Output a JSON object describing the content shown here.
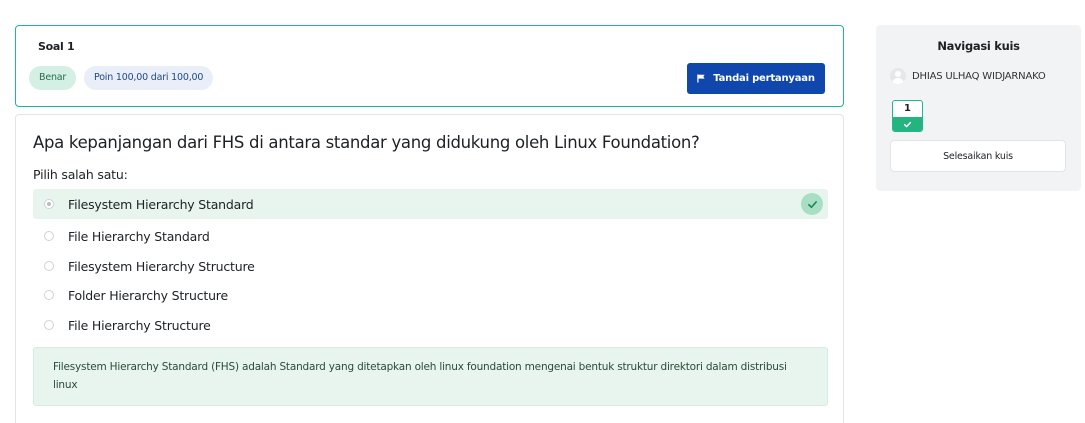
{
  "question_info": {
    "number_label": "Soal 1",
    "state": "Benar",
    "grade": "Poin 100,00 dari 100,00",
    "flag_label": "Tandai pertanyaan"
  },
  "question": {
    "text": "Apa kepanjangan dari FHS di antara standar yang didukung oleh Linux Foundation?",
    "prompt": "Pilih salah satu:",
    "answers": [
      {
        "label": "Filesystem Hierarchy Standard",
        "selected": true,
        "correct": true
      },
      {
        "label": "File Hierarchy Standard",
        "selected": false,
        "correct": false
      },
      {
        "label": "Filesystem Hierarchy Structure",
        "selected": false,
        "correct": false
      },
      {
        "label": "Folder Hierarchy Structure",
        "selected": false,
        "correct": false
      },
      {
        "label": "File Hierarchy Structure",
        "selected": false,
        "correct": false
      }
    ],
    "feedback": "Filesystem Hierarchy Standard (FHS) adalah Standard yang ditetapkan oleh linux foundation mengenai bentuk struktur direktori dalam distribusi linux"
  },
  "navigation": {
    "title": "Navigasi kuis",
    "user_name": "DHIAS ULHAQ WIDJARNAKO",
    "questions": [
      {
        "number": "1",
        "state": "correct"
      }
    ],
    "finish_label": "Selesaikan kuis"
  },
  "colors": {
    "accent_border": "#1fb59a",
    "primary_button": "#0f47ad",
    "correct_bg": "#e7f5ee",
    "correct_green": "#24b47e"
  },
  "icons": {
    "flag": "flag-icon",
    "check": "check-icon",
    "avatar": "user-avatar-icon"
  }
}
